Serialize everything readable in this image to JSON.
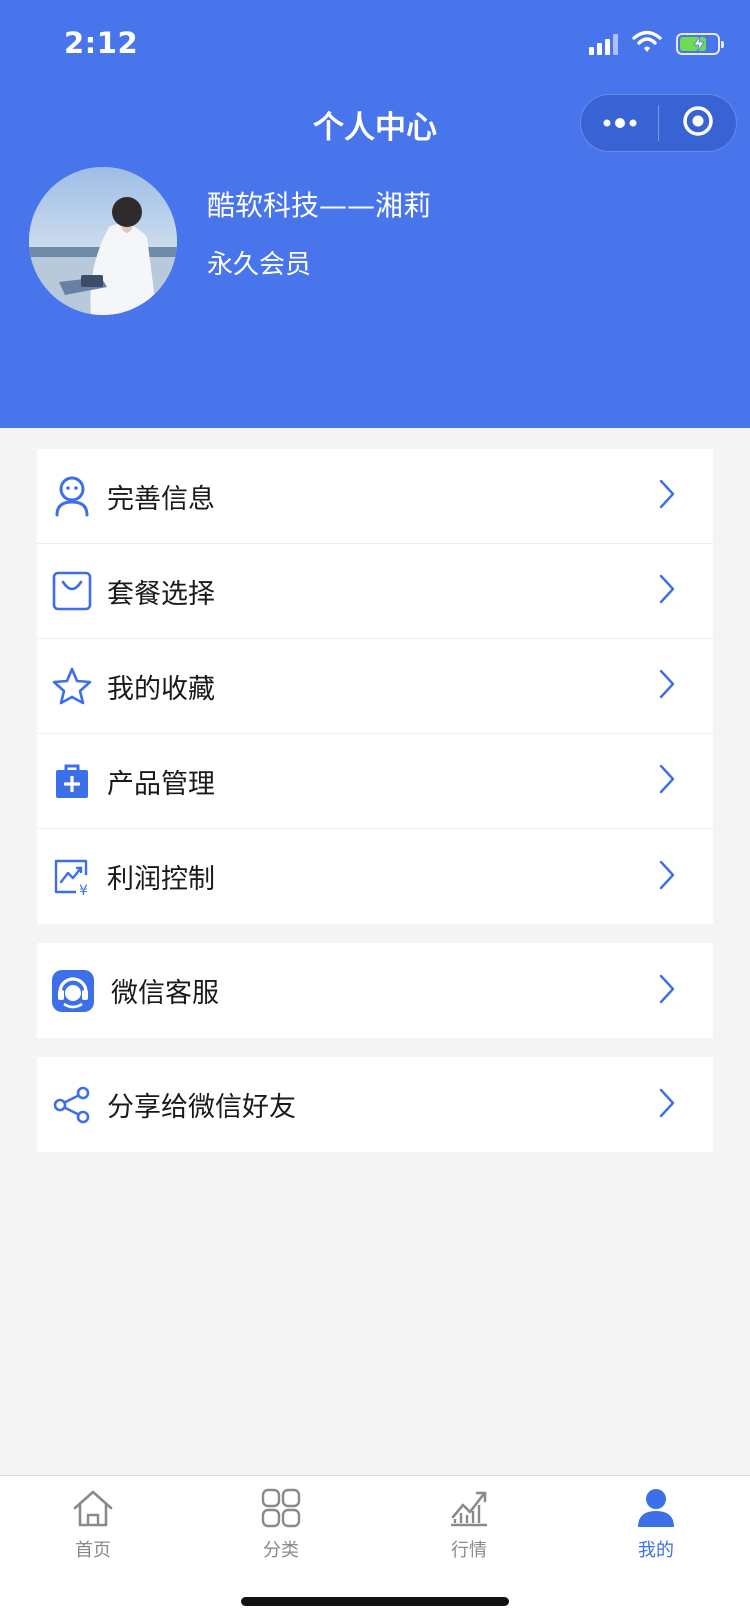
{
  "status_bar": {
    "time": "2:12"
  },
  "header": {
    "title": "个人中心"
  },
  "user": {
    "name": "酷软科技——湘莉",
    "level": "永久会员"
  },
  "menu_group_1": [
    {
      "label": "完善信息",
      "icon": "user-profile-icon"
    },
    {
      "label": "套餐选择",
      "icon": "shopping-bag-icon"
    },
    {
      "label": "我的收藏",
      "icon": "star-icon"
    },
    {
      "label": "产品管理",
      "icon": "medical-kit-icon"
    },
    {
      "label": "利润控制",
      "icon": "profit-chart-icon"
    }
  ],
  "menu_group_2": [
    {
      "label": "微信客服",
      "icon": "customer-service-icon"
    }
  ],
  "menu_group_3": [
    {
      "label": "分享给微信好友",
      "icon": "share-icon"
    }
  ],
  "tabbar": [
    {
      "label": "首页",
      "icon": "home-icon",
      "active": false
    },
    {
      "label": "分类",
      "icon": "category-grid-icon",
      "active": false
    },
    {
      "label": "行情",
      "icon": "market-trend-icon",
      "active": false
    },
    {
      "label": "我的",
      "icon": "person-icon",
      "active": true
    }
  ],
  "colors": {
    "primary": "#4975ec",
    "background": "#f4f4f4",
    "active_tab": "#3d6fe9",
    "inactive_tab": "#8a8a8a"
  }
}
